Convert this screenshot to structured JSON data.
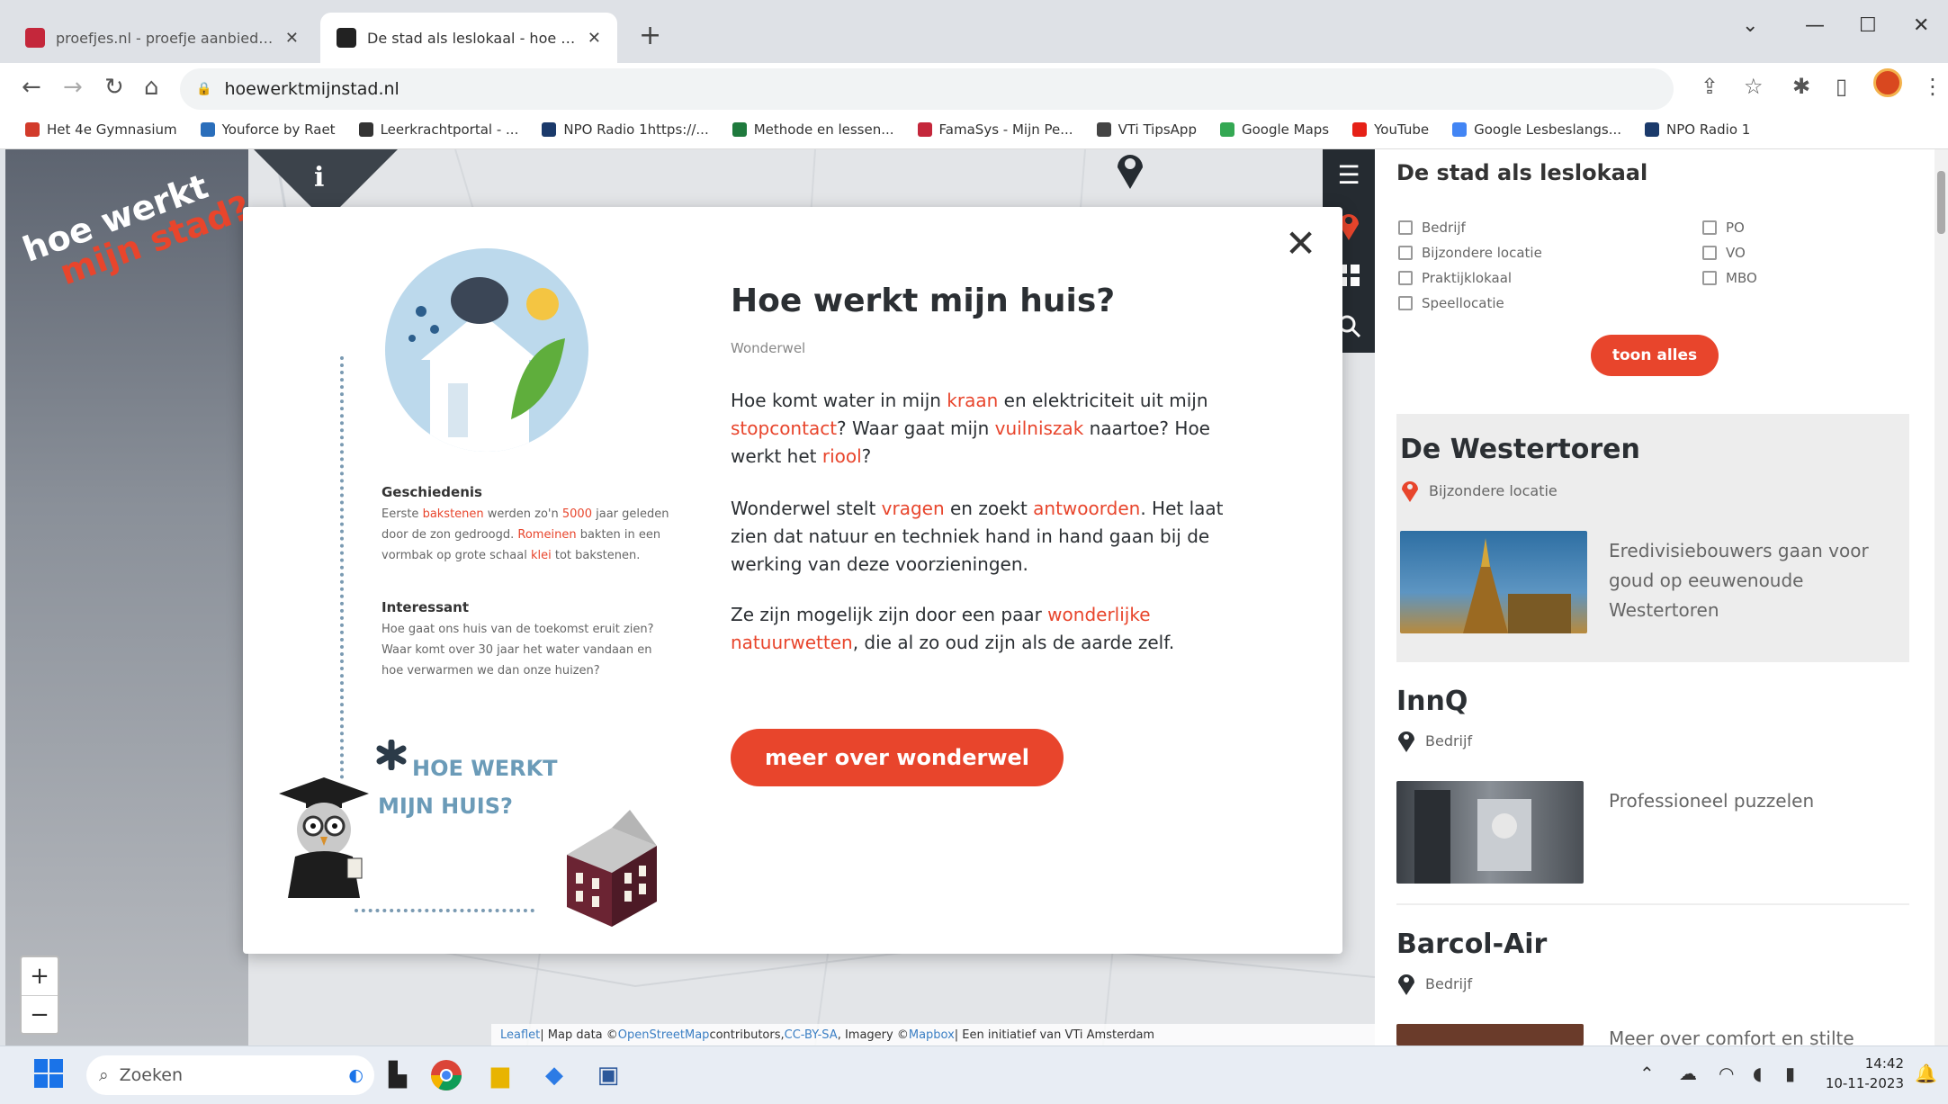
{
  "browser": {
    "tabs": [
      {
        "title": "proefjes.nl - proefje aanbieden",
        "active": false
      },
      {
        "title": "De stad als leslokaal - hoe werkt mijn stad",
        "active": true
      }
    ],
    "new_tab": "+",
    "url": "hoewerktmijnstad.nl",
    "bookmarks": [
      {
        "label": "Het 4e Gymnasium",
        "color": "#d23b2b"
      },
      {
        "label": "Youforce by Raet",
        "color": "#2a6ebb"
      },
      {
        "label": "Leerkrachtportal - ...",
        "color": "#333333"
      },
      {
        "label": "NPO Radio 1https://...",
        "color": "#1b3a6b"
      },
      {
        "label": "Methode en lessen...",
        "color": "#1f7a3d"
      },
      {
        "label": "FamaSys - Mijn Pe...",
        "color": "#c4273b"
      },
      {
        "label": "VTi TipsApp",
        "color": "#444444"
      },
      {
        "label": "Google Maps",
        "color": "#34a853"
      },
      {
        "label": "YouTube",
        "color": "#e62117"
      },
      {
        "label": "Google Lesbeslangs...",
        "color": "#4285f4"
      },
      {
        "label": "NPO Radio 1",
        "color": "#1b3a6b"
      }
    ]
  },
  "map": {
    "logo_line1": "hoe werkt",
    "logo_line2": "mijn stad?",
    "info_icon": "i",
    "zoom_in": "+",
    "zoom_out": "−",
    "attribution": {
      "leaflet": "Leaflet",
      "data_prefix": " | Map data © ",
      "osm": "OpenStreetMap",
      "contrib": " contributors, ",
      "ccbysa": "CC-BY-SA",
      "imagery": ", Imagery © ",
      "mapbox": "Mapbox",
      "initiative": " | Een initiatief van VTi Amsterdam"
    }
  },
  "modal": {
    "title": "Hoe werkt mijn huis?",
    "subtitle": "Wonderwel",
    "close": "✕",
    "side": {
      "history_title": "Geschiedenis",
      "history_parts": [
        "Eerste ",
        "bakstenen",
        " werden zo'n ",
        "5000",
        " jaar geleden door de zon gedroogd. ",
        "Romeinen",
        " bakten in een vormbak op grote schaal ",
        "klei",
        " tot bakstenen."
      ],
      "interesting_title": "Interessant",
      "interesting_text": "Hoe gaat ons huis van de toekomst eruit zien? Waar komt over 30 jaar het water vandaan en hoe verwarmen we dan onze huizen?",
      "brand_line1": "HOE WERKT",
      "brand_line2": "MIJN HUIS?"
    },
    "p1": [
      "Hoe komt water in mijn ",
      "kraan",
      " en elektriciteit uit mijn ",
      "stopcontact",
      "? Waar gaat mijn ",
      "vuilniszak",
      " naartoe? Hoe werkt het ",
      "riool",
      "?"
    ],
    "p2": [
      "Wonderwel stelt ",
      "vragen",
      " en zoekt ",
      "antwoorden",
      ". Het laat zien dat natuur en techniek hand in hand gaan bij de werking van deze voorzieningen."
    ],
    "p3": [
      "Ze zijn mogelijk zijn door een paar ",
      "wonderlijke natuurwetten",
      ", die al zo oud zijn als de aarde zelf."
    ],
    "button": "meer over wonderwel"
  },
  "panel": {
    "title": "De stad als leslokaal",
    "filters_left": [
      "Bedrijf",
      "Bijzondere locatie",
      "Praktijklokaal",
      "Speellocatie"
    ],
    "filters_right": [
      "PO",
      "VO",
      "MBO"
    ],
    "show_all": "toon alles",
    "locations": [
      {
        "title": "De Westertoren",
        "category": "Bijzondere locatie",
        "description": "Eredivisiebouwers gaan voor goud op eeuwenoude Westertoren"
      },
      {
        "title": "InnQ",
        "category": "Bedrijf",
        "description": "Professioneel puzzelen"
      },
      {
        "title": "Barcol-Air",
        "category": "Bedrijf",
        "description": "Meer over comfort en stilte"
      }
    ]
  },
  "taskbar": {
    "search_placeholder": "Zoeken",
    "time": "14:42",
    "date": "10-11-2023"
  },
  "colors": {
    "accent": "#e8452c",
    "dark": "#252b31",
    "brand_blue": "#6b9bb8"
  }
}
